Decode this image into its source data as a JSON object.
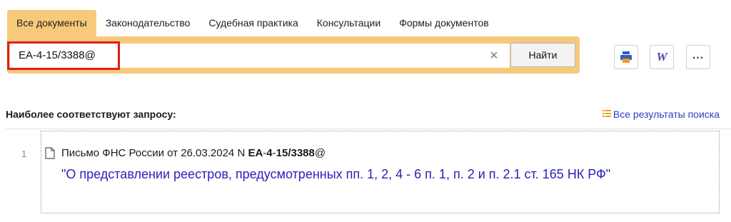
{
  "tabs": [
    {
      "label": "Все документы",
      "active": true
    },
    {
      "label": "Законодательство",
      "active": false
    },
    {
      "label": "Судебная практика",
      "active": false
    },
    {
      "label": "Консультации",
      "active": false
    },
    {
      "label": "Формы документов",
      "active": false
    }
  ],
  "search": {
    "value": "ЕА-4-15/3388@",
    "button_label": "Найти",
    "clear_icon": "×"
  },
  "toolbar": {
    "print_icon": "print-icon",
    "word_icon": "word-icon",
    "word_glyph": "W",
    "more_glyph": "..."
  },
  "results_header": {
    "title": "Наиболее соответствуют запросу:",
    "all_results_link": "Все результаты поиска"
  },
  "results": [
    {
      "number": "1",
      "meta_prefix": "Письмо ФНС России от 26.03.2024 N ",
      "meta_doc_parts": [
        "ЕА",
        "-",
        "4",
        "-",
        "15",
        "/",
        "3388"
      ],
      "meta_suffix": "@",
      "title": "\"О представлении реестров, предусмотренных пп. 1, 2, 4 - 6 п. 1, п. 2 и п. 2.1 ст. 165 НК РФ\""
    }
  ],
  "colors": {
    "tab_active_bg": "#f7c97a",
    "search_panel": "#f7c97a",
    "highlight_border": "#e01d1d",
    "link_blue": "#2b22b8",
    "print_icon_blue": "#2f5fc1",
    "print_icon_orange": "#f29a24",
    "word_icon": "#5b3fb3"
  }
}
